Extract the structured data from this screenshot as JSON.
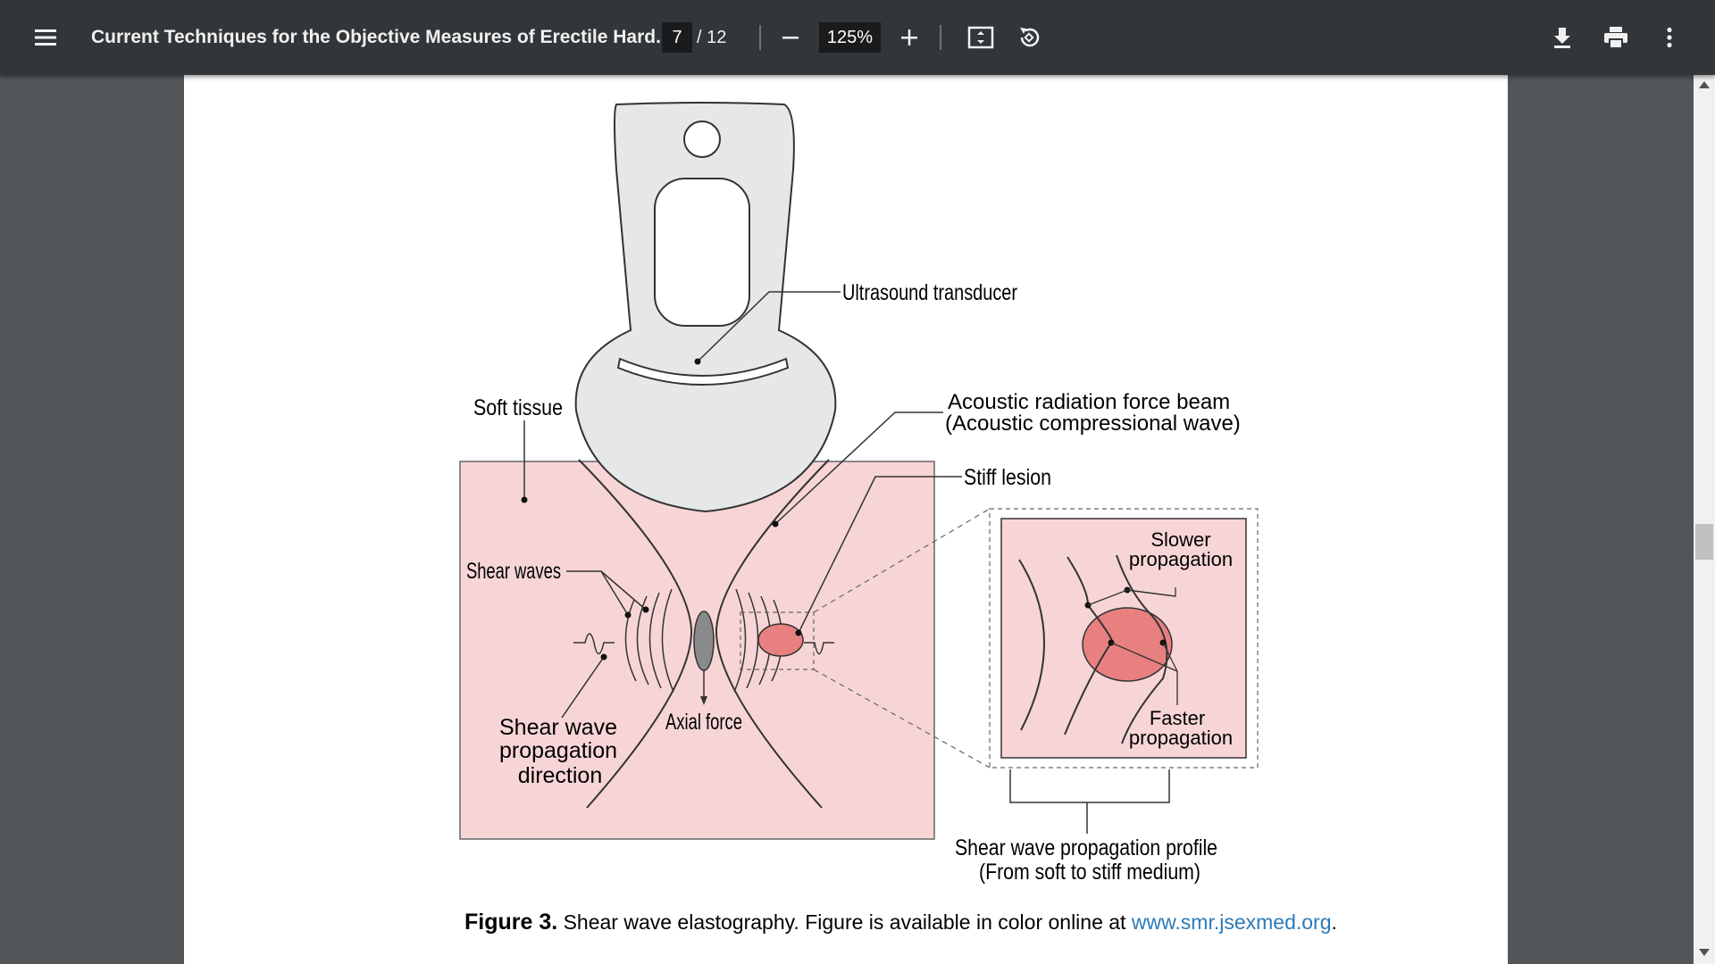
{
  "toolbar": {
    "title": "Current Techniques for the Objective Measures of Erectile Hard...",
    "current_page": "7",
    "page_total": "/ 12",
    "zoom": "125%",
    "icons": [
      "menu-icon",
      "zoom-out-icon",
      "zoom-in-icon",
      "fit-page-icon",
      "rotate-icon",
      "download-icon",
      "print-icon",
      "more-icon"
    ]
  },
  "figure": {
    "labels": {
      "ultrasound_transducer": "Ultrasound transducer",
      "soft_tissue": "Soft tissue",
      "acoustic_beam_line1": "Acoustic radiation force beam",
      "acoustic_beam_line2": "(Acoustic compressional wave)",
      "stiff_lesion": "Stiff lesion",
      "shear_waves": "Shear waves",
      "slower_line1": "Slower",
      "slower_line2": "propagation",
      "faster_line1": "Faster",
      "faster_line2": "propagation",
      "axial_force": "Axial force",
      "propagation_dir_line1": "Shear wave",
      "propagation_dir_line2": "propagation",
      "propagation_dir_line3": "direction",
      "profile_line1": "Shear wave propagation profile",
      "profile_line2": "(From soft to stiff medium)"
    },
    "caption": {
      "label": "Figure 3.",
      "text": " Shear wave elastography. Figure is available in color online at ",
      "link": "www.smr.jsexmed.org",
      "end": "."
    },
    "colors": {
      "tissue": "#f7d5d6",
      "lesion": "#e88080",
      "transducer": "#e6e7e8",
      "link": "#2b7ab8"
    }
  }
}
